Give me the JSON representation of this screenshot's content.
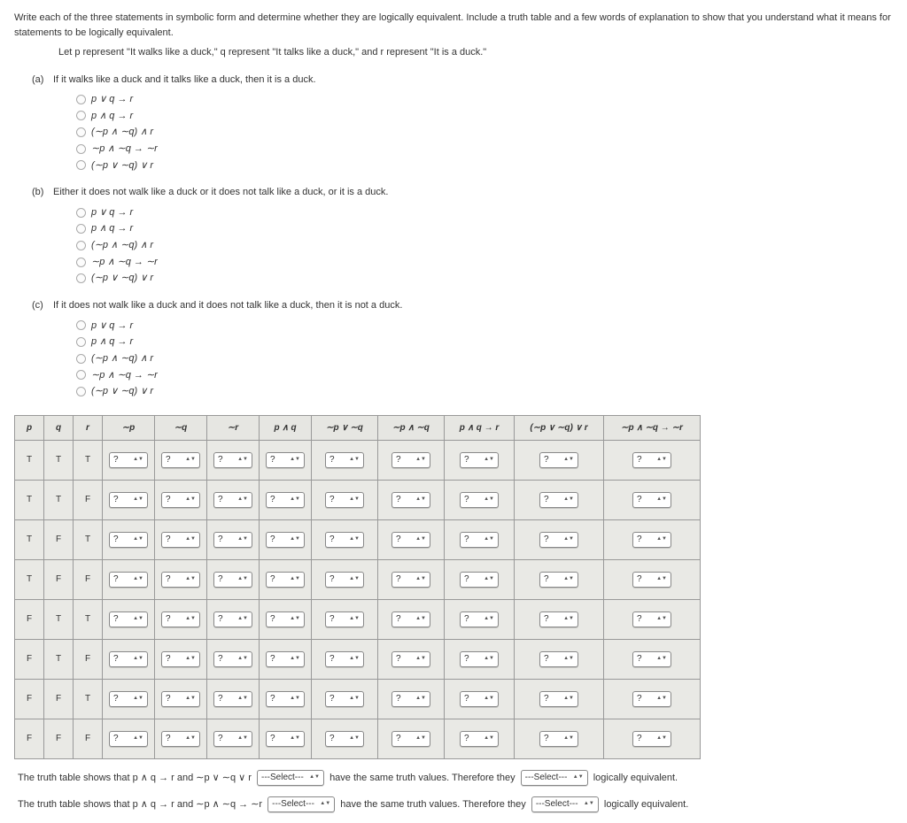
{
  "intro": {
    "line1": "Write each of the three statements in symbolic form and determine whether they are logically equivalent. Include a truth table and a few words of explanation to show that you understand what it means for statements to be logically equivalent.",
    "line2": "Let p represent \"It walks like a duck,\" q represent \"It talks like a duck,\" and r represent \"It is a duck.\""
  },
  "options": [
    "p ∨ q → r",
    "p ∧ q → r",
    "(∼p ∧ ∼q) ∧ r",
    "∼p ∧ ∼q → ∼r",
    "(∼p ∨ ∼q) ∨ r"
  ],
  "parts": [
    {
      "label": "(a)",
      "text": "If it walks like a duck and it talks like a duck, then it is a duck."
    },
    {
      "label": "(b)",
      "text": "Either it does not walk like a duck or it does not talk like a duck, or it is a duck."
    },
    {
      "label": "(c)",
      "text": "If it does not walk like a duck and it does not talk like a duck, then it is not a duck."
    }
  ],
  "table": {
    "headers": [
      "p",
      "q",
      "r",
      "∼p",
      "∼q",
      "∼r",
      "p ∧ q",
      "∼p ∨ ∼q",
      "∼p ∧ ∼q",
      "p ∧ q → r",
      "(∼p ∨ ∼q) ∨ r",
      "∼p ∧ ∼q → ∼r"
    ],
    "pqr": [
      [
        "T",
        "T",
        "T"
      ],
      [
        "T",
        "T",
        "F"
      ],
      [
        "T",
        "F",
        "T"
      ],
      [
        "T",
        "F",
        "F"
      ],
      [
        "F",
        "T",
        "T"
      ],
      [
        "F",
        "T",
        "F"
      ],
      [
        "F",
        "F",
        "T"
      ],
      [
        "F",
        "F",
        "F"
      ]
    ],
    "placeholder": "?"
  },
  "conclusions": {
    "c1a": "The truth table shows that p ∧ q → r and ∼p ∨ ∼q ∨ r",
    "c1b": "have the same truth values. Therefore they",
    "c1c": "logically equivalent.",
    "c2a": "The truth table shows that p ∧ q → r and ∼p ∧ ∼q → ∼r",
    "c2b": "have the same truth values. Therefore they",
    "c2c": "logically equivalent.",
    "select_placeholder": "---Select---"
  }
}
